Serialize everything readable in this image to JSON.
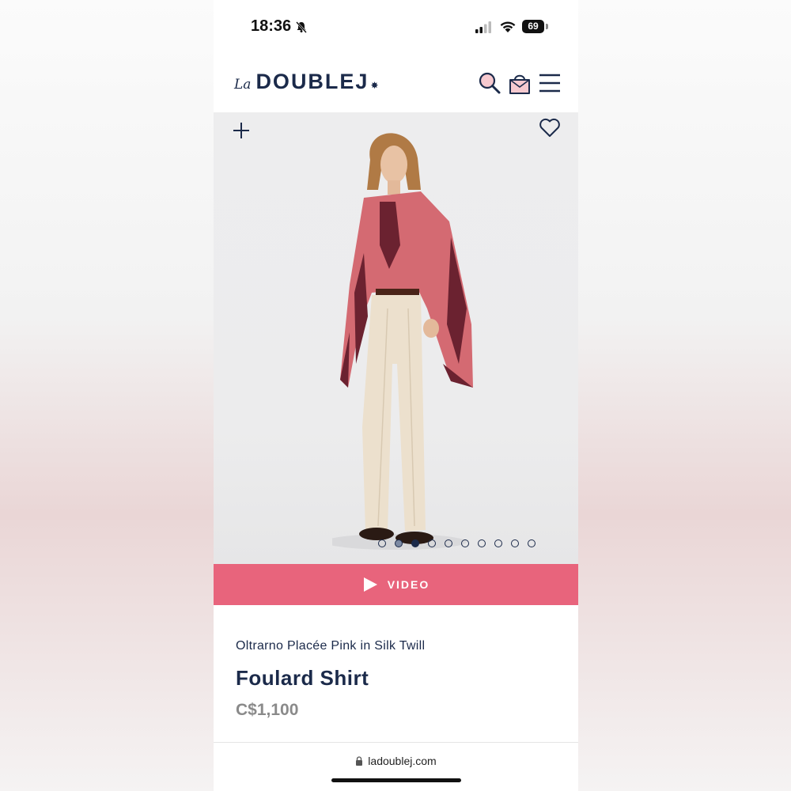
{
  "status_bar": {
    "time": "18:36",
    "battery": "69"
  },
  "header": {
    "logo_prefix": "La",
    "logo_main": "DOUBLEJ",
    "logo_mark": "✸",
    "icons": [
      "search-icon",
      "bag-icon",
      "menu-icon"
    ]
  },
  "gallery": {
    "icons": [
      "plus-icon",
      "heart-icon"
    ],
    "image_count": 10,
    "active_index": 2
  },
  "video": {
    "label": "VIDEO"
  },
  "product": {
    "subtitle": "Oltrarno Placée Pink in Silk Twill",
    "title": "Foulard Shirt",
    "price": "C$1,100"
  },
  "browser": {
    "url": "ladoublej.com"
  },
  "colors": {
    "brand_navy": "#1b2a4a",
    "video_pink": "#e8647c",
    "price_gray": "#8a8a8a"
  }
}
